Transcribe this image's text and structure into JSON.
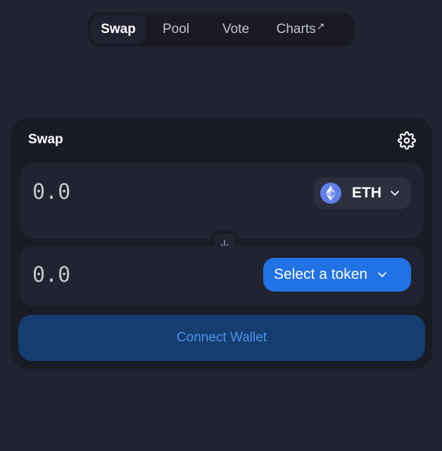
{
  "nav": {
    "items": [
      {
        "label": "Swap",
        "active": true
      },
      {
        "label": "Pool",
        "active": false
      },
      {
        "label": "Vote",
        "active": false
      },
      {
        "label": "Charts",
        "active": false,
        "external_mark": "↗"
      }
    ]
  },
  "swap": {
    "title": "Swap",
    "settings_icon": "gear-icon",
    "input": {
      "amount_placeholder": "0.0",
      "token": {
        "symbol": "ETH",
        "icon": "ethereum-logo"
      }
    },
    "switch_icon": "arrow-down-icon",
    "output": {
      "amount_placeholder": "0.0",
      "select_label": "Select a token"
    },
    "connect_label": "Connect Wallet"
  },
  "colors": {
    "background": "#222331",
    "card": "#191b25",
    "panel": "#222330",
    "accent": "#2172e5",
    "connect_bg": "#153d6f",
    "connect_text": "#5090ea",
    "eth": "#627eea"
  }
}
